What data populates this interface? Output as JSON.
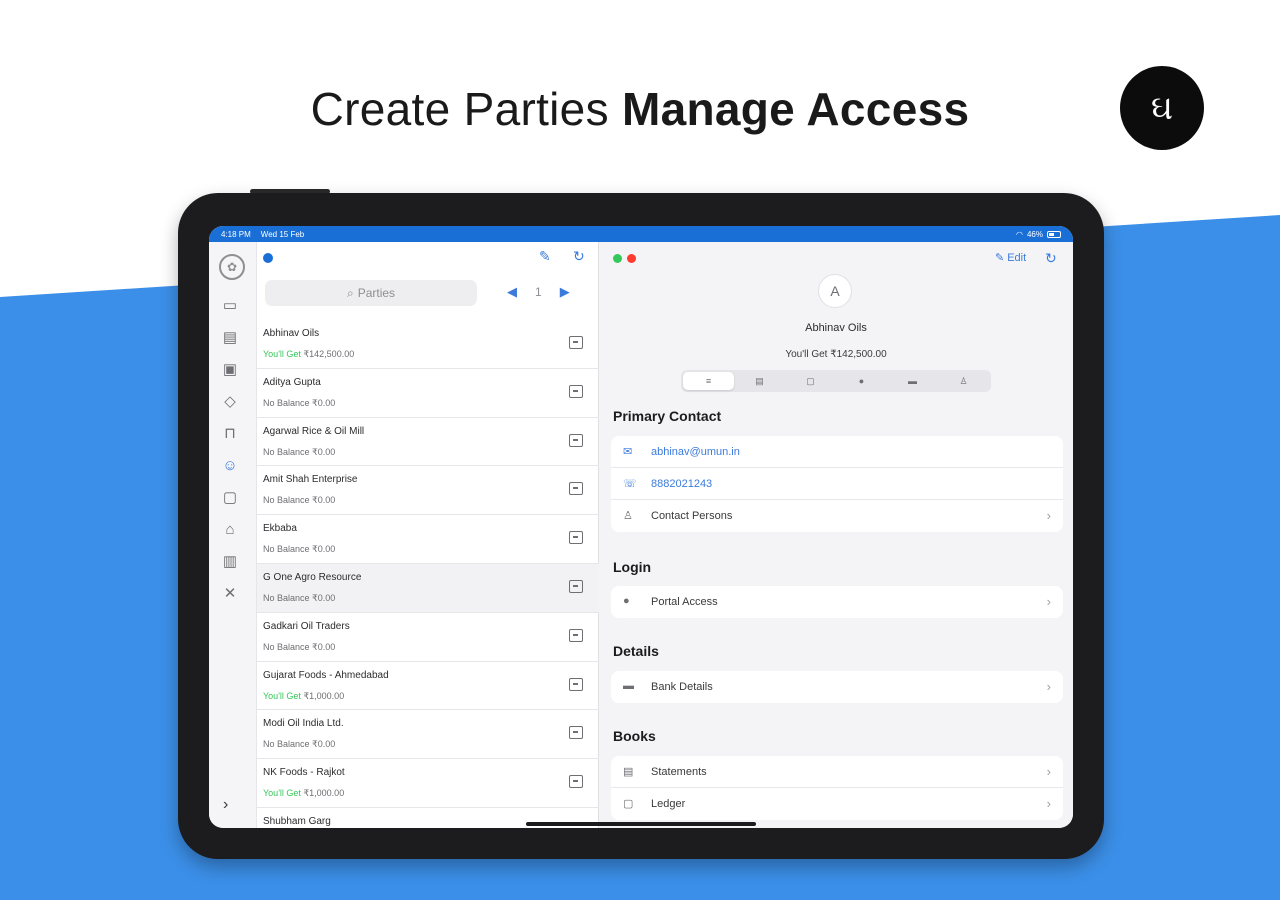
{
  "headline": {
    "part1": "Create Parties",
    "part2": "Manage Access"
  },
  "logo": {
    "text": "ઘ"
  },
  "status_bar": {
    "time": "4:18 PM",
    "date": "Wed 15 Feb",
    "battery": "46%"
  },
  "colors": {
    "accent": "#3b7bdc",
    "status_blue": "#1a6fd6",
    "positive": "#34c759",
    "page_blue": "#3b8fe8"
  },
  "rail": {
    "icons": [
      "app-logo-icon",
      "inbox-icon",
      "document-icon",
      "money-icon",
      "tag-icon",
      "bag-icon",
      "people-icon",
      "wallet-icon",
      "basket-icon",
      "building-icon",
      "tools-icon"
    ],
    "expand": "›"
  },
  "list": {
    "search_placeholder": "Parties",
    "page": "1",
    "prev": "◀",
    "next": "▶",
    "items": [
      {
        "name": "Abhinav Oils",
        "label": "You'll Get",
        "amount": "₹142,500.00",
        "positive": true
      },
      {
        "name": "Aditya Gupta",
        "label": "No Balance",
        "amount": "₹0.00",
        "positive": false
      },
      {
        "name": "Agarwal Rice & Oil Mill",
        "label": "No Balance",
        "amount": "₹0.00",
        "positive": false
      },
      {
        "name": "Amit Shah Enterprise",
        "label": "No Balance",
        "amount": "₹0.00",
        "positive": false
      },
      {
        "name": "Ekbaba",
        "label": "No Balance",
        "amount": "₹0.00",
        "positive": false
      },
      {
        "name": "G One Agro Resource",
        "label": "No Balance",
        "amount": "₹0.00",
        "positive": false
      },
      {
        "name": "Gadkari Oil Traders",
        "label": "No Balance",
        "amount": "₹0.00",
        "positive": false
      },
      {
        "name": "Gujarat Foods - Ahmedabad",
        "label": "You'll Get",
        "amount": "₹1,000.00",
        "positive": true
      },
      {
        "name": "Modi Oil India Ltd.",
        "label": "No Balance",
        "amount": "₹0.00",
        "positive": false
      },
      {
        "name": "NK Foods - Rajkot",
        "label": "You'll Get",
        "amount": "₹1,000.00",
        "positive": true
      },
      {
        "name": "Shubham Garg",
        "label": "",
        "amount": "",
        "positive": false
      }
    ]
  },
  "detail": {
    "edit_label": "Edit",
    "avatar_letter": "A",
    "name": "Abhinav Oils",
    "balance": "You'll Get  ₹142,500.00",
    "segments": [
      "list-icon",
      "document-icon",
      "book-icon",
      "globe-icon",
      "card-icon",
      "person-icon"
    ],
    "primary_contact": {
      "title": "Primary Contact",
      "email": "abhinav@umun.in",
      "phone": "8882021243",
      "contact_persons": "Contact Persons"
    },
    "login": {
      "title": "Login",
      "portal_access": "Portal Access"
    },
    "details": {
      "title": "Details",
      "bank_details": "Bank Details"
    },
    "books": {
      "title": "Books",
      "statements": "Statements",
      "ledger": "Ledger"
    }
  }
}
